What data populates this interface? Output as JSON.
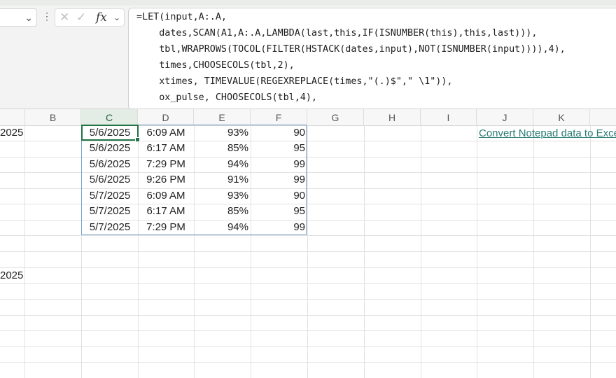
{
  "formula_bar": {
    "lines": [
      "=LET(input,A:.A,",
      "    dates,SCAN(A1,A:.A,LAMBDA(last,this,IF(ISNUMBER(this),this,last))),",
      "    tbl,WRAPROWS(TOCOL(FILTER(HSTACK(dates,input),NOT(ISNUMBER(input)))),4),",
      "    times,CHOOSECOLS(tbl,2),",
      "    xtimes, TIMEVALUE(REGEXREPLACE(times,\"(.)$\",\" \\1\")),",
      "    ox_pulse, CHOOSECOLS(tbl,4),"
    ],
    "fx_label": "fx",
    "cancel_icon": "close-icon",
    "enter_icon": "checkmark-icon"
  },
  "columns": [
    "B",
    "C",
    "D",
    "E",
    "F",
    "G",
    "H",
    "I",
    "J",
    "K"
  ],
  "selected_column": "C",
  "column_a_partial": [
    "2025",
    "2025"
  ],
  "table": {
    "rows": [
      [
        "5/6/2025",
        "6:09 AM",
        "93%",
        "90"
      ],
      [
        "5/6/2025",
        "6:17 AM",
        "85%",
        "95"
      ],
      [
        "5/6/2025",
        "7:29 PM",
        "94%",
        "99"
      ],
      [
        "5/6/2025",
        "9:26 PM",
        "91%",
        "99"
      ],
      [
        "5/7/2025",
        "6:09 AM",
        "93%",
        "90"
      ],
      [
        "5/7/2025",
        "6:17 AM",
        "85%",
        "95"
      ],
      [
        "5/7/2025",
        "7:29 PM",
        "94%",
        "99"
      ]
    ]
  },
  "link_text": "Convert Notepad data to Excel",
  "colors": {
    "accent": "#217346",
    "link": "#2a7c75",
    "spill_border": "#7aa3c9"
  }
}
